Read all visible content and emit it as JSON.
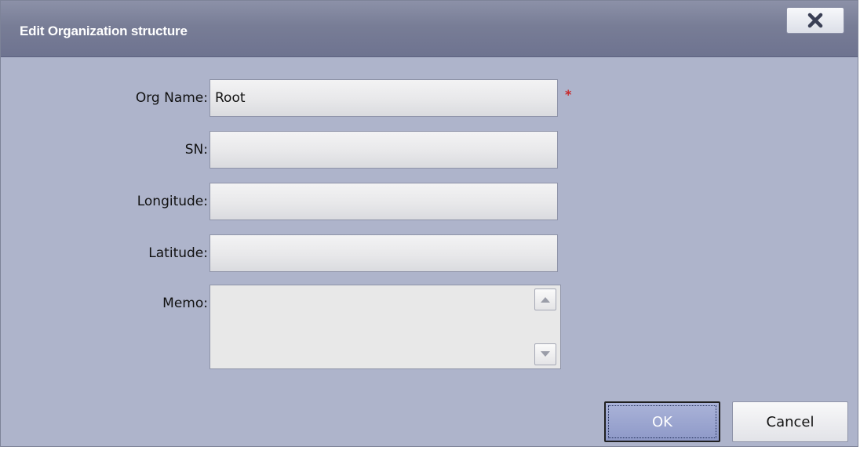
{
  "dialog": {
    "title": "Edit Organization structure",
    "close_icon": "close-x-icon"
  },
  "form": {
    "org_name": {
      "label": "Org Name:",
      "value": "Root",
      "required_mark": "*"
    },
    "sn": {
      "label": "SN:",
      "value": ""
    },
    "longitude": {
      "label": "Longitude:",
      "value": ""
    },
    "latitude": {
      "label": "Latitude:",
      "value": ""
    },
    "memo": {
      "label": "Memo:",
      "value": ""
    }
  },
  "buttons": {
    "ok_label": "OK",
    "cancel_label": "Cancel"
  },
  "colors": {
    "dialog_bg": "#aeb4cb",
    "titlebar": "#787d96",
    "ok_button": "#8e99c8",
    "required_mark": "#c8282a"
  }
}
